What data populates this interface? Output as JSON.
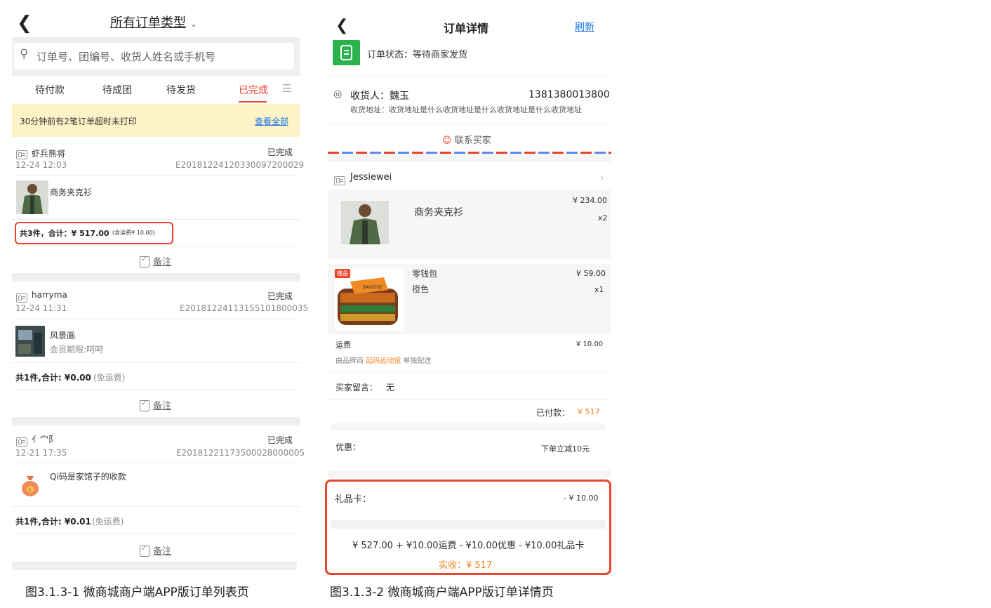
{
  "left": {
    "back_icon": "chevron-left-icon",
    "title": "所有订单类型",
    "search_placeholder": "订单号、团编号、收货人姓名或手机号",
    "tabs": [
      "待付款",
      "待成团",
      "待发货",
      "已完成"
    ],
    "notice_text": "30分钟前有2笔订单超时未打印",
    "notice_link": "查看全部",
    "orders": [
      {
        "buyer": "虾兵熊将",
        "time": "12-24 12:03",
        "status": "已完成",
        "order_no": "E20181224120330097200029",
        "item_name": "商务夹克衫",
        "item_sub": "",
        "summary": "共3件，合计：¥ 517.00",
        "summary_extra": "(含运费¥ 10.00)",
        "remark": "备注"
      },
      {
        "buyer": "harryma",
        "time": "12-24 11:31",
        "status": "已完成",
        "order_no": "E20181224113155101800035",
        "item_name": "风景画",
        "item_sub": "会员期限:呵呵",
        "summary": "共1件,合计: ¥0.00",
        "summary_extra": "(免运费)",
        "remark": "备注"
      },
      {
        "buyer": "亻宀阝",
        "time": "12-21 17:35",
        "status": "已完成",
        "order_no": "E20181221173500028000005",
        "item_name": "Qi码是家馆子的收款",
        "item_sub": "",
        "summary": "共1件,合计: ¥0.01",
        "summary_extra": "(免运费)",
        "remark": "备注"
      }
    ],
    "caption": "图3.1.3-1 微商城商户端APP版订单列表页"
  },
  "right": {
    "back_icon": "chevron-left-icon",
    "title": "订单详情",
    "refresh": "刷新",
    "status_text": "订单状态：等待商家发货",
    "receiver_label": "收货人：魏玉",
    "phone": "1381380013800",
    "address": "收货地址：收货地址是什么收货地址是什么收货地址是什么收货地址",
    "contact": "联系买家",
    "buyer": "Jessiewei",
    "items": [
      {
        "name": "商务夹克衫",
        "spec": "",
        "price": "¥ 234.00",
        "qty": "x2",
        "tag": ""
      },
      {
        "name": "零钱包",
        "spec": "橙色",
        "price": "¥ 59.00",
        "qty": "x1",
        "tag": "赠品"
      }
    ],
    "shipping_label": "运费",
    "shipping_value": "¥ 10.00",
    "shipping_note_pre": "由品牌商",
    "shipping_note_brand": "起码运动馆",
    "shipping_note_post": "单独配送",
    "message_label": "买家留言：",
    "message_value": "无",
    "paid_label": "已付款：",
    "paid_value": "¥ 517",
    "discount_label": "优惠：",
    "discount_value": "下单立减10元",
    "giftcard_label": "礼品卡：",
    "giftcard_value": "- ¥ 10.00",
    "formula": "¥ 527.00 + ¥10.00运费 - ¥10.00优惠 - ¥10.00礼品卡",
    "actual": "实收：¥ 517",
    "caption": "图3.1.3-2 微商城商户端APP版订单详情页"
  },
  "colors": {
    "accent_red": "#e8452c",
    "orange": "#f5821f",
    "link_blue": "#1a73e8",
    "notice_bg": "#fdf3c6",
    "status_green": "#2bb24c"
  }
}
